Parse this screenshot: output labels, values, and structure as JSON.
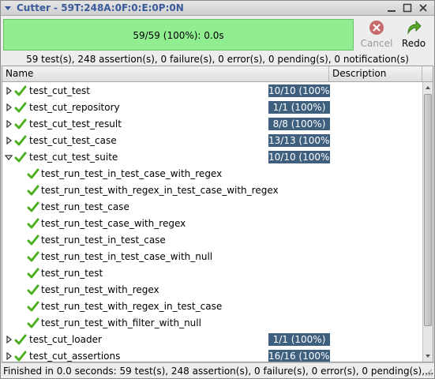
{
  "window": {
    "title": "Cutter - 59T:248A:0F:0:E:0P:0N"
  },
  "toolbar": {
    "progress_text": "59/59 (100%): 0.0s",
    "progress_fraction": 1.0,
    "cancel_label": "Cancel",
    "redo_label": "Redo"
  },
  "summary": "59 test(s), 248 assertion(s), 0 failure(s), 0 error(s), 0 pending(s), 0 notification(s)",
  "columns": {
    "name": "Name",
    "description": "Description"
  },
  "rows": [
    {
      "name": "test_cut_test",
      "badge": "10/10 (100%)",
      "expander": "collapsed",
      "level": 0
    },
    {
      "name": "test_cut_repository",
      "badge": "1/1 (100%)",
      "expander": "collapsed",
      "level": 0
    },
    {
      "name": "test_cut_test_result",
      "badge": "8/8 (100%)",
      "expander": "collapsed",
      "level": 0
    },
    {
      "name": "test_cut_test_case",
      "badge": "13/13 (100%)",
      "expander": "collapsed",
      "level": 0
    },
    {
      "name": "test_cut_test_suite",
      "badge": "10/10 (100%)",
      "expander": "expanded",
      "level": 0
    },
    {
      "name": "test_run_test_in_test_case_with_regex",
      "badge": "",
      "expander": "none",
      "level": 1
    },
    {
      "name": "test_run_test_with_regex_in_test_case_with_regex",
      "badge": "",
      "expander": "none",
      "level": 1
    },
    {
      "name": "test_run_test_case",
      "badge": "",
      "expander": "none",
      "level": 1
    },
    {
      "name": "test_run_test_case_with_regex",
      "badge": "",
      "expander": "none",
      "level": 1
    },
    {
      "name": "test_run_test_in_test_case",
      "badge": "",
      "expander": "none",
      "level": 1
    },
    {
      "name": "test_run_test_in_test_case_with_null",
      "badge": "",
      "expander": "none",
      "level": 1
    },
    {
      "name": "test_run_test",
      "badge": "",
      "expander": "none",
      "level": 1
    },
    {
      "name": "test_run_test_with_regex",
      "badge": "",
      "expander": "none",
      "level": 1
    },
    {
      "name": "test_run_test_with_regex_in_test_case",
      "badge": "",
      "expander": "none",
      "level": 1
    },
    {
      "name": "test_run_test_with_filter_with_null",
      "badge": "",
      "expander": "none",
      "level": 1
    },
    {
      "name": "test_cut_loader",
      "badge": "1/1 (100%)",
      "expander": "collapsed",
      "level": 0
    },
    {
      "name": "test_cut_assertions",
      "badge": "16/16 (100%)",
      "expander": "collapsed",
      "level": 0
    }
  ],
  "status": "Finished in 0.0 seconds: 59 test(s), 248 assertion(s), 0 failure(s), 0 error(s), 0 pending(s),...",
  "colors": {
    "progress_fill": "#90ee90",
    "badge_bg": "#3f5f7f",
    "check_green": "#4caf20",
    "title_text": "#3a5a9a",
    "cancel_red": "#c0392b"
  },
  "icons": {
    "window_menu": "window-menu-icon",
    "cancel": "cancel-icon",
    "redo": "redo-icon",
    "success": "check-icon"
  }
}
